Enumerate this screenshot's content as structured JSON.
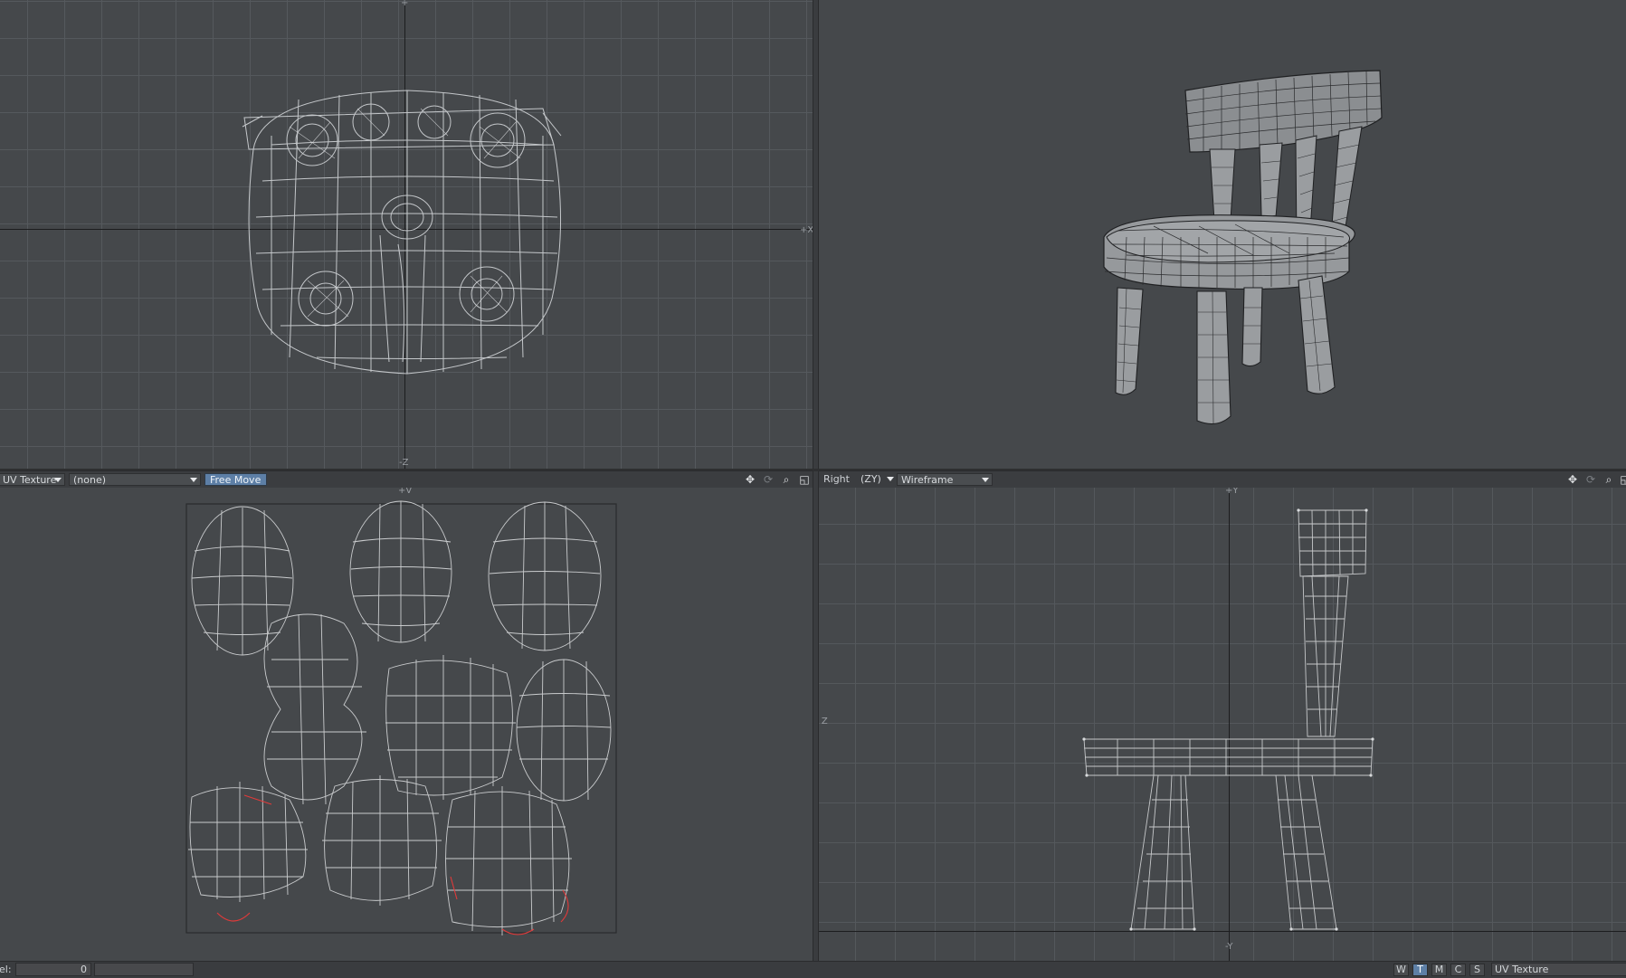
{
  "viewports": {
    "top_left": {
      "axis_top": "+",
      "axis_right": "+X",
      "axis_bottom": "-Z"
    },
    "top_right": {},
    "bottom_left": {
      "projection_label": "UV Texture",
      "uv_map_label": "(none)",
      "tool_label": "Free Move",
      "axis_top": "+V",
      "controls": [
        "move-icon",
        "rotate-icon",
        "zoom-icon",
        "maximize-icon"
      ]
    },
    "bottom_right": {
      "view_label": "Right",
      "axes_label": "(ZY)",
      "render_mode_label": "Wireframe",
      "axis_top": "+Y",
      "axis_left": "+U Z",
      "axis_bottom": "-Y",
      "controls": [
        "move-icon",
        "rotate-icon",
        "zoom-icon",
        "maximize-icon"
      ]
    }
  },
  "status_bar": {
    "level_label": "el:",
    "level_value": "0",
    "modes": [
      "W",
      "T",
      "M",
      "C",
      "S"
    ],
    "active_mode": "T",
    "map_label": "UV Texture"
  },
  "colors": {
    "background": "#45484b",
    "wire": "#c8cacc",
    "seam": "#e03a3a",
    "accent": "#5d7fa6"
  }
}
